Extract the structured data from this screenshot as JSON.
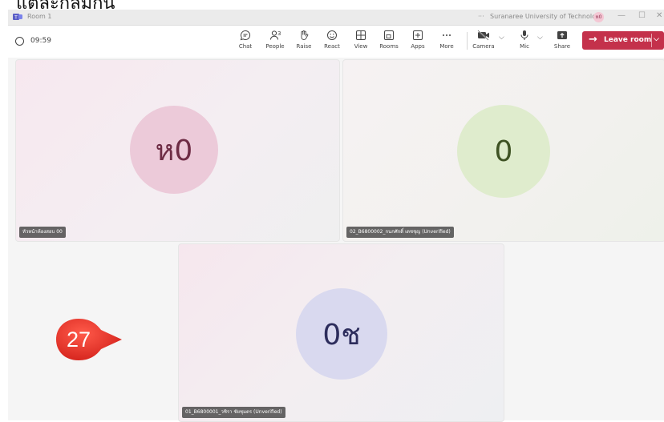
{
  "caption": "แต่ละกลุ่มกัน",
  "titlebar": {
    "title": "Room 1",
    "dots": "···",
    "org": "Suranaree University of Technology",
    "avatar_initials": "ห0",
    "minimize": "—",
    "maximize": "☐",
    "close": "✕"
  },
  "toolbar": {
    "timer": "09:59",
    "people_count": "3",
    "items": [
      {
        "label": "Chat",
        "icon": "chat-icon"
      },
      {
        "label": "People",
        "icon": "people-icon"
      },
      {
        "label": "Raise",
        "icon": "raise-hand-icon"
      },
      {
        "label": "React",
        "icon": "react-icon"
      },
      {
        "label": "View",
        "icon": "view-icon"
      },
      {
        "label": "Rooms",
        "icon": "rooms-icon"
      },
      {
        "label": "Apps",
        "icon": "apps-icon"
      },
      {
        "label": "More",
        "icon": "more-icon"
      }
    ],
    "camera_label": "Camera",
    "mic_label": "Mic",
    "share_label": "Share",
    "leave_label": "Leave room",
    "leave_color": "#c4314b"
  },
  "participants": [
    {
      "initials": "ห0",
      "name": "หัวหน้าห้องสอบ 00",
      "color": "#eccad9"
    },
    {
      "initials": "0",
      "name": "02_B6800002_กนกศักดิ์ เดชชุญ (Unverified)",
      "color": "#dfeccd"
    },
    {
      "initials": "0ช",
      "name": "01_B6800001_วชิรา ชัยชุมตร (Unverified)",
      "color": "#d9d9ef"
    }
  ],
  "step_badge": "27"
}
